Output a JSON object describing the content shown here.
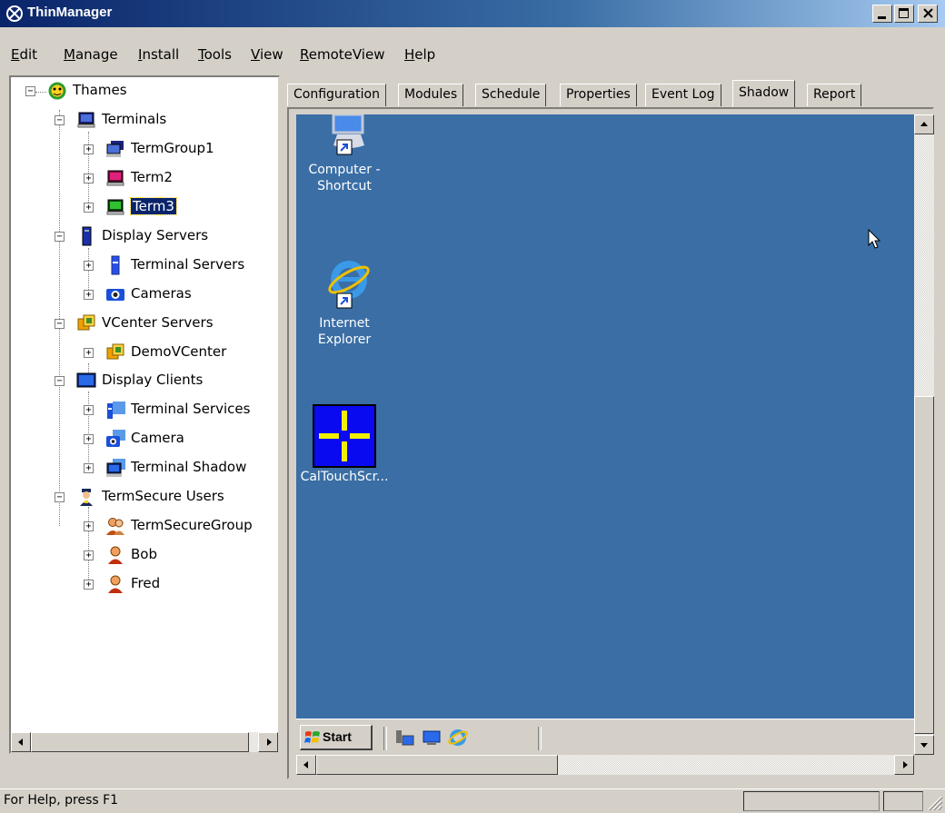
{
  "window": {
    "title": "ThinManager"
  },
  "menu": [
    "Edit",
    "Manage",
    "Install",
    "Tools",
    "View",
    "RemoteView",
    "Help"
  ],
  "tree": {
    "root": "Thames",
    "groups": [
      {
        "label": "Terminals",
        "children": [
          "TermGroup1",
          "Term2",
          "Term3"
        ]
      },
      {
        "label": "Display Servers",
        "children": [
          "Terminal Servers",
          "Cameras"
        ]
      },
      {
        "label": "VCenter Servers",
        "children": [
          "DemoVCenter"
        ]
      },
      {
        "label": "Display Clients",
        "children": [
          "Terminal Services",
          "Camera",
          "Terminal Shadow"
        ]
      },
      {
        "label": "TermSecure Users",
        "children": [
          "TermSecureGroup",
          "Bob",
          "Fred"
        ]
      }
    ],
    "selected": "Term3"
  },
  "tabs": [
    "Configuration",
    "Modules",
    "Schedule",
    "Properties",
    "Event Log",
    "Shadow",
    "Report"
  ],
  "active_tab": "Shadow",
  "desktop": {
    "icons": [
      {
        "label_line1": "Computer -",
        "label_line2": "Shortcut"
      },
      {
        "label_line1": "Internet",
        "label_line2": "Explorer"
      },
      {
        "label_line1": "CalTouchScr...",
        "label_line2": ""
      }
    ],
    "start_label": "Start"
  },
  "status": {
    "help_text": "For Help, press F1"
  },
  "colors": {
    "desktop_bg": "#3a6ea5",
    "selection": "#0a246a"
  }
}
